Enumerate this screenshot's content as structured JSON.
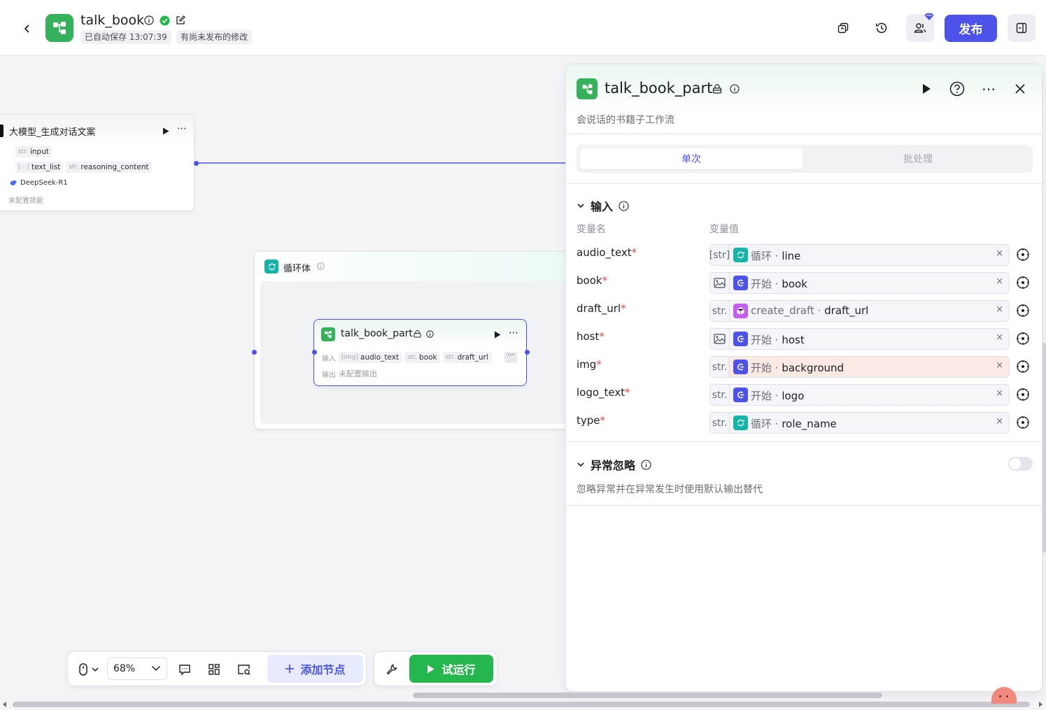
{
  "header": {
    "app_title": "talk_book",
    "autosave_text": "已自动保存 13:07:39",
    "unpublished_text": "有尚未发布的修改",
    "publish_label": "发布"
  },
  "llm_node": {
    "title": "大模型_生成对话文案",
    "input_chip": "input",
    "output_chip_1": "text_list",
    "output_chip_2": "reasoning_content",
    "model": "DeepSeek-R1",
    "skills_text": "未配置技能",
    "type_str": "str.",
    "type_list": "[⋯]"
  },
  "loop_node": {
    "title": "循环体"
  },
  "sub_node": {
    "title": "talk_book_part",
    "input_label": "输入",
    "output_label": "输出",
    "chip_1": "audio_text",
    "chip_2": "book",
    "chip_3": "draft_url",
    "output_text": "未配置输出",
    "type_img": "[img]",
    "type_str": "str."
  },
  "panel": {
    "title": "talk_book_part",
    "description": "会说话的书籍子工作流",
    "tab_single": "单次",
    "tab_batch": "批处理",
    "input_section": "输入",
    "col_name": "变量名",
    "col_value": "变量值",
    "rows": [
      {
        "name": "audio_text",
        "type": "[str]",
        "source": "循环",
        "var": "line",
        "src_color": "#16b3a7"
      },
      {
        "name": "book",
        "type": "img",
        "source": "开始",
        "var": "book",
        "src_color": "#4d53e8"
      },
      {
        "name": "draft_url",
        "type": "str.",
        "source": "create_draft",
        "var": "draft_url",
        "src_color": "#c55ef0"
      },
      {
        "name": "host",
        "type": "img",
        "source": "开始",
        "var": "host",
        "src_color": "#4d53e8"
      },
      {
        "name": "img",
        "type": "str.",
        "source": "开始",
        "var": "background",
        "src_color": "#4d53e8",
        "warning": true
      },
      {
        "name": "logo_text",
        "type": "str.",
        "source": "开始",
        "var": "logo",
        "src_color": "#4d53e8"
      },
      {
        "name": "type",
        "type": "str.",
        "source": "循环",
        "var": "role_name",
        "src_color": "#16b3a7"
      }
    ],
    "required_mark": "*",
    "sep": " · ",
    "clear": "×",
    "exception_section": "异常忽略",
    "exception_desc": "忽略异常并在异常发生时使用默认输出替代",
    "exception_enabled": false
  },
  "toolbar": {
    "zoom": "68%",
    "add_node": "添加节点",
    "test_run": "试运行"
  },
  "colors": {
    "accent": "#4d53e8",
    "brand_green": "#35b05b",
    "run_green": "#25b64d",
    "loop_teal": "#16b3a7"
  }
}
